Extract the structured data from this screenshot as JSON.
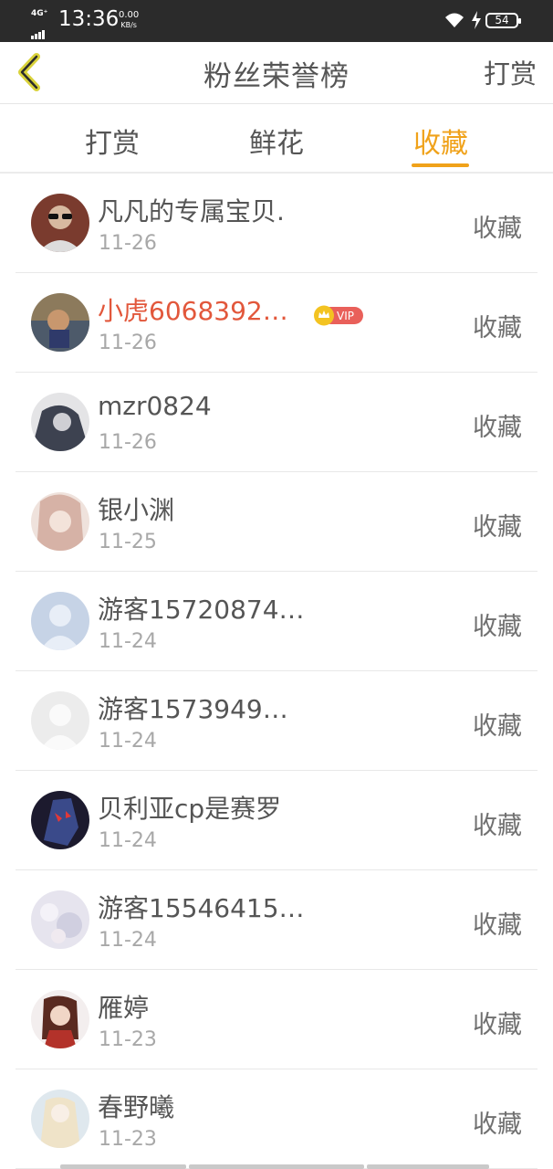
{
  "status_bar": {
    "network": "4G⁺",
    "time": "13:36",
    "speed_value": "0.00",
    "speed_unit": "KB/s",
    "battery": "54"
  },
  "header": {
    "title": "粉丝荣誉榜",
    "action_label": "打赏"
  },
  "tabs": [
    {
      "label": "打赏",
      "active": false
    },
    {
      "label": "鲜花",
      "active": false
    },
    {
      "label": "收藏",
      "active": true
    }
  ],
  "accent_color": "#f0a21a",
  "vip_name_color": "#e2573b",
  "fans": [
    {
      "name": "凡凡的专属宝贝.",
      "date": "11-26",
      "action": "收藏",
      "vip": false,
      "avatar_color": "#7a3b2e"
    },
    {
      "name": "小虎6068392…",
      "date": "11-26",
      "action": "收藏",
      "vip": true,
      "vip_label": "VIP",
      "avatar_color": "#6a5a40"
    },
    {
      "name": "mzr0824",
      "date": "11-26",
      "action": "收藏",
      "vip": false,
      "avatar_color": "#4a4f5a"
    },
    {
      "name": "银小渊",
      "date": "11-25",
      "action": "收藏",
      "vip": false,
      "avatar_color": "#d9b8ae"
    },
    {
      "name": "游客15720874…",
      "date": "11-24",
      "action": "收藏",
      "vip": false,
      "avatar_color": "#c6d3e6"
    },
    {
      "name": "游客1573949…",
      "date": "11-24",
      "action": "收藏",
      "vip": false,
      "avatar_color": "#ececec"
    },
    {
      "name": "贝利亚cp是赛罗",
      "date": "11-24",
      "action": "收藏",
      "vip": false,
      "avatar_color": "#2a2540"
    },
    {
      "name": "游客15546415…",
      "date": "11-24",
      "action": "收藏",
      "vip": false,
      "avatar_color": "#dcdde6"
    },
    {
      "name": "雁婷",
      "date": "11-23",
      "action": "收藏",
      "vip": false,
      "avatar_color": "#7a3a2a"
    },
    {
      "name": "春野曦",
      "date": "11-23",
      "action": "收藏",
      "vip": false,
      "avatar_color": "#e8dcc4"
    }
  ]
}
